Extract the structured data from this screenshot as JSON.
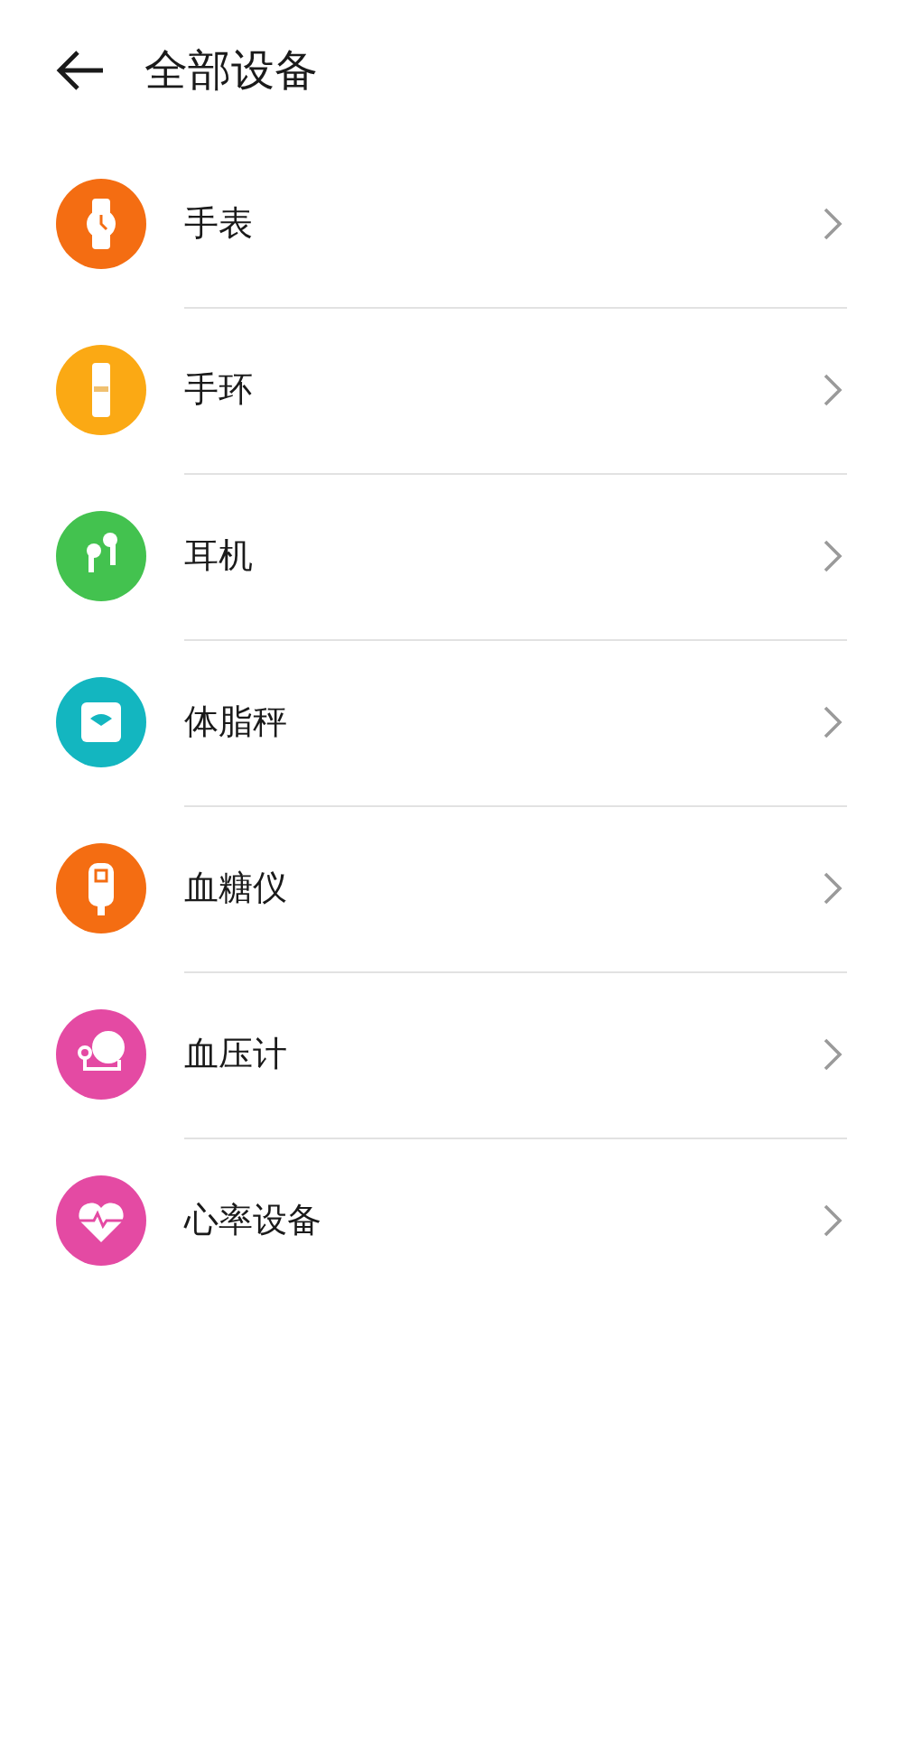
{
  "header": {
    "title": "全部设备"
  },
  "devices": [
    {
      "label": "手表",
      "kind": "watch",
      "color": "#f46d12"
    },
    {
      "label": "手环",
      "kind": "band",
      "color": "#fba914"
    },
    {
      "label": "耳机",
      "kind": "earbuds",
      "color": "#43c24f"
    },
    {
      "label": "体脂秤",
      "kind": "scale",
      "color": "#13b6c0"
    },
    {
      "label": "血糖仪",
      "kind": "glucose",
      "color": "#f46d12"
    },
    {
      "label": "血压计",
      "kind": "pressure",
      "color": "#e44aa3"
    },
    {
      "label": "心率设备",
      "kind": "heart",
      "color": "#e44aa3"
    }
  ]
}
